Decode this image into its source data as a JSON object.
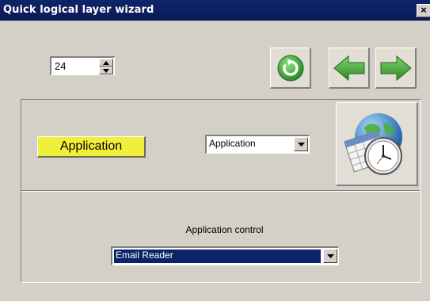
{
  "window": {
    "title": "Quick logical layer wizard",
    "close_label": "×"
  },
  "stepper": {
    "value": "24"
  },
  "toolbar": {
    "refresh_icon": "refresh-icon",
    "back_icon": "arrow-left-icon",
    "forward_icon": "arrow-right-icon",
    "accent_green": "#3fa83a"
  },
  "main": {
    "app_button_label": "Application",
    "app_button_color": "#f0f03c",
    "type_select_value": "Application",
    "schedule_icon": "calendar-clock-globe-icon"
  },
  "control": {
    "label": "Application control",
    "select_value": "Email Reader",
    "selection_color": "#0a246a"
  }
}
